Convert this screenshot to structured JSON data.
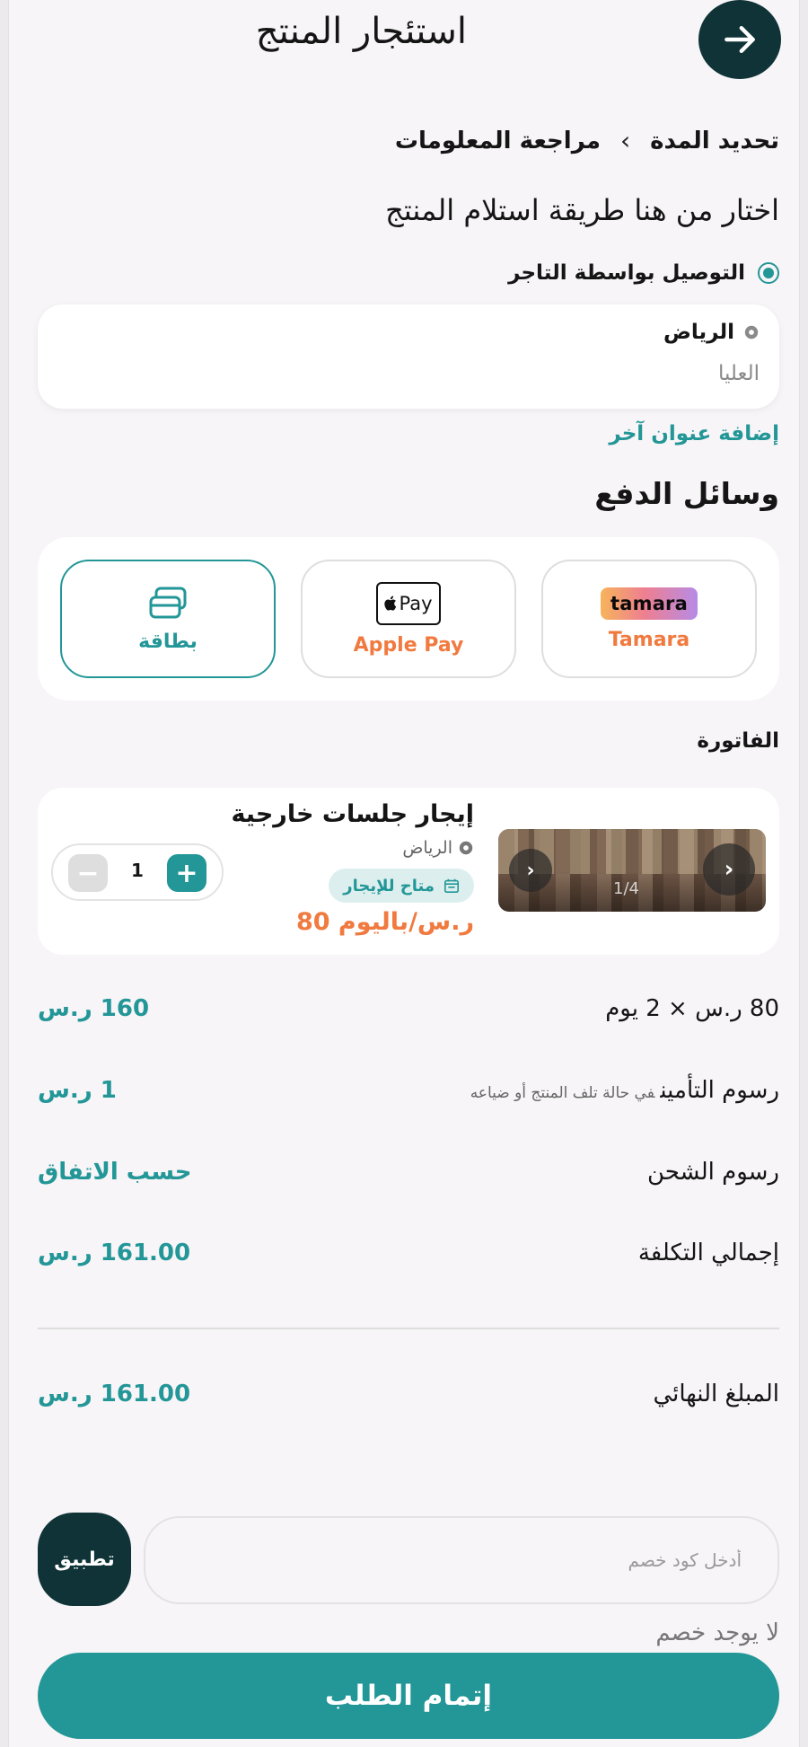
{
  "header": {
    "title": "استئجار المنتج",
    "back_icon": "arrow-right-icon"
  },
  "steps": {
    "step1": "تحديد المدة",
    "step2": "مراجعة المعلومات"
  },
  "delivery": {
    "section_title": "اختار من هنا طريقة استلام المنتج",
    "option_label": "التوصيل بواسطة التاجر",
    "address_city": "الرياض",
    "address_district": "العليا",
    "add_address": "إضافة عنوان آخر"
  },
  "payment": {
    "title": "وسائل الدفع",
    "options": [
      {
        "label": "Tamara",
        "logo_text": "tamara",
        "selected": false
      },
      {
        "label": "Apple Pay",
        "logo_text": "Pay",
        "selected": false
      },
      {
        "label": "بطاقة",
        "selected": true
      }
    ]
  },
  "invoice": {
    "title": "الفاتورة",
    "product": {
      "name": "إيجار جلسات خارجية",
      "location": "الرياض",
      "badge": "متاح للإيجار",
      "price": "80 ر.س/باليوم",
      "image_counter": "1/4",
      "quantity": "1"
    },
    "rows": [
      {
        "label": "80 ر.س × 2 يوم",
        "note": "",
        "value": "160 ر.س"
      },
      {
        "label": "رسوم التأمين",
        "note": "في حالة تلف المنتج أو ضياعه",
        "value": "1 ر.س"
      },
      {
        "label": "رسوم الشحن",
        "note": "",
        "value": "حسب الاتفاق"
      },
      {
        "label": "إجمالي التكلفة",
        "note": "",
        "value": "161.00 ر.س"
      }
    ],
    "final_label": "المبلغ النهائي",
    "final_value": "161.00 ر.س"
  },
  "discount": {
    "apply_label": "تطبيق",
    "placeholder": "أدخل كود خصم",
    "no_discount": "لا يوجد خصم"
  },
  "submit_label": "إتمام الطلب",
  "colors": {
    "primary": "#239697",
    "dark": "#0f3336",
    "accent": "#f07a3f",
    "background": "#f7f5f7"
  }
}
